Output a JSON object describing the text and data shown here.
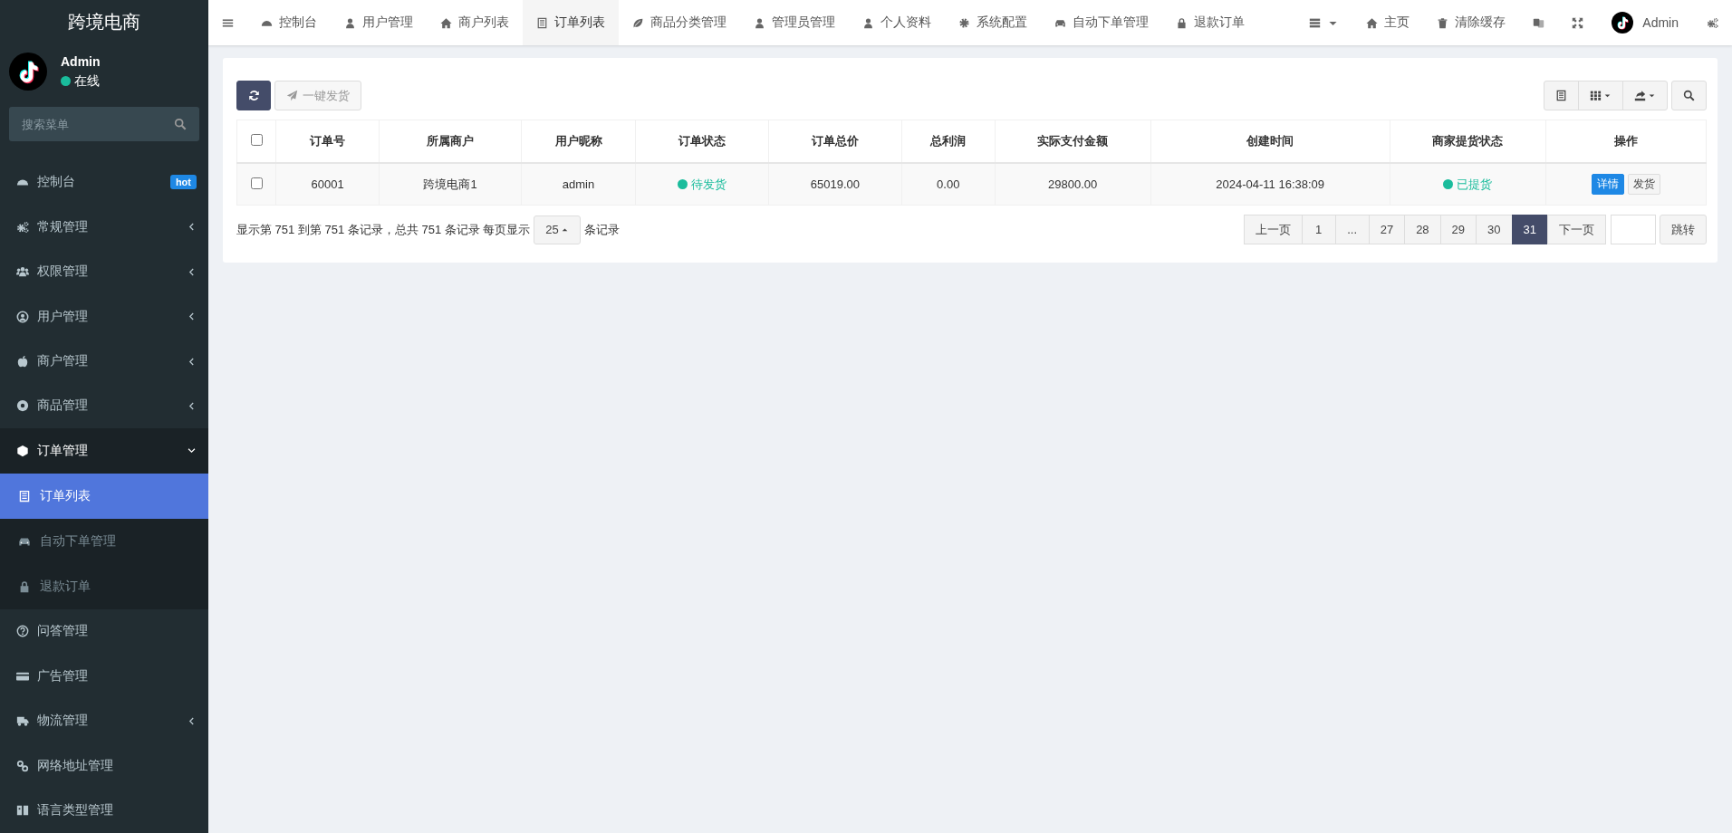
{
  "brand": {
    "title": "跨境电商"
  },
  "user": {
    "name": "Admin",
    "status": "在线",
    "online": true
  },
  "sidebar": {
    "search": {
      "placeholder": "搜索菜单"
    },
    "items": [
      {
        "label": "控制台",
        "badge": "hot"
      },
      {
        "label": "常规管理",
        "expanded": false
      },
      {
        "label": "权限管理",
        "expanded": false
      },
      {
        "label": "用户管理",
        "expanded": false
      },
      {
        "label": "商户管理",
        "expanded": false
      },
      {
        "label": "商品管理",
        "expanded": false
      },
      {
        "label": "订单管理",
        "expanded": true,
        "children": [
          {
            "label": "订单列表",
            "selected": true
          },
          {
            "label": "自动下单管理",
            "selected": false
          },
          {
            "label": "退款订单",
            "selected": false
          }
        ]
      },
      {
        "label": "问答管理"
      },
      {
        "label": "广告管理"
      },
      {
        "label": "物流管理",
        "expanded": false
      },
      {
        "label": "网络地址管理"
      },
      {
        "label": "语言类型管理"
      }
    ]
  },
  "top_tabs": [
    {
      "label": "控制台",
      "selected": false
    },
    {
      "label": "用户管理",
      "selected": false
    },
    {
      "label": "商户列表",
      "selected": false
    },
    {
      "label": "订单列表",
      "selected": true
    },
    {
      "label": "商品分类管理",
      "selected": false
    },
    {
      "label": "管理员管理",
      "selected": false
    },
    {
      "label": "个人资料",
      "selected": false
    },
    {
      "label": "系统配置",
      "selected": false
    },
    {
      "label": "自动下单管理",
      "selected": false
    },
    {
      "label": "退款订单",
      "selected": false
    }
  ],
  "top_right": {
    "home": "主页",
    "clear_cache": "清除缓存",
    "user": "Admin"
  },
  "toolbar": {
    "ship_button": {
      "label": "一键发货",
      "disabled": true
    }
  },
  "table": {
    "select_all_checked": false,
    "columns": [
      "订单号",
      "所属商户",
      "用户昵称",
      "订单状态",
      "订单总价",
      "总利润",
      "实际支付金额",
      "创建时间",
      "商家提货状态",
      "操作"
    ],
    "rows": [
      {
        "checked": false,
        "order_no": "60001",
        "merchant": "跨境电商1",
        "nickname": "admin",
        "status": {
          "text": "待发货",
          "color": "#1abc9c"
        },
        "total": "65019.00",
        "profit": "0.00",
        "paid": "29800.00",
        "created": "2024-04-11 16:38:09",
        "pickup_status": {
          "text": "已提货",
          "color": "#1abc9c"
        },
        "actions": [
          {
            "label": "详情",
            "kind": "primary"
          },
          {
            "label": "发货",
            "kind": "default"
          }
        ]
      }
    ]
  },
  "pagination": {
    "summary": "显示第 751 到第 751 条记录，总共 751 条记录 每页显示",
    "page_size": "25",
    "summary_end": "条记录",
    "pages": [
      {
        "label": "上一页",
        "selected": false
      },
      {
        "label": "1",
        "selected": false
      },
      {
        "label": "...",
        "selected": false
      },
      {
        "label": "27",
        "selected": false
      },
      {
        "label": "28",
        "selected": false
      },
      {
        "label": "29",
        "selected": false
      },
      {
        "label": "30",
        "selected": false
      },
      {
        "label": "31",
        "selected": true
      },
      {
        "label": "下一页",
        "selected": false
      }
    ],
    "jump_button": "跳转"
  }
}
